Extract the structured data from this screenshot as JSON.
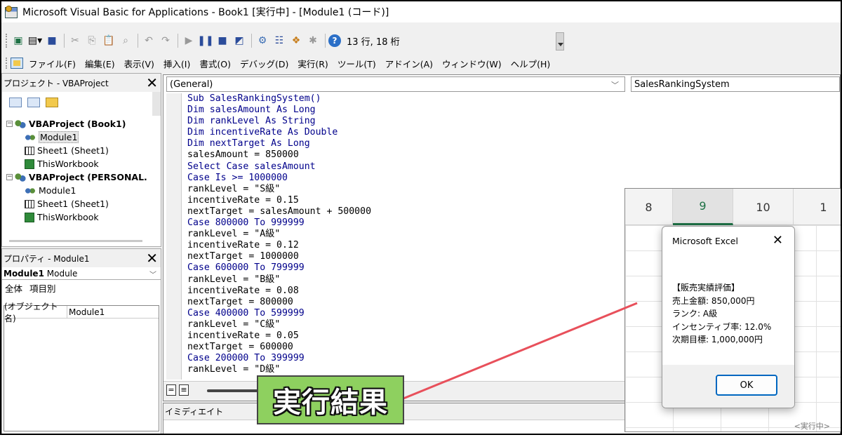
{
  "window": {
    "title": "Microsoft Visual Basic for Applications - Book1 [実行中] - [Module1 (コード)]"
  },
  "toolbar": {
    "status": "13 行, 18 桁"
  },
  "menu": [
    "ファイル(F)",
    "編集(E)",
    "表示(V)",
    "挿入(I)",
    "書式(O)",
    "デバッグ(D)",
    "実行(R)",
    "ツール(T)",
    "アドイン(A)",
    "ウィンドウ(W)",
    "ヘルプ(H)"
  ],
  "project": {
    "title": "プロジェクト - VBAProject",
    "close": "✕",
    "tree": [
      {
        "label": "VBAProject (Book1)",
        "kind": "project",
        "level": 0
      },
      {
        "label": "Module1",
        "kind": "module",
        "level": 1
      },
      {
        "label": "Sheet1 (Sheet1)",
        "kind": "sheet",
        "level": 1
      },
      {
        "label": "ThisWorkbook",
        "kind": "workbook",
        "level": 1
      },
      {
        "label": "VBAProject (PERSONAL.",
        "kind": "project",
        "level": 0
      },
      {
        "label": "Module1",
        "kind": "module",
        "level": 1
      },
      {
        "label": "Sheet1 (Sheet1)",
        "kind": "sheet",
        "level": 1
      },
      {
        "label": "ThisWorkbook",
        "kind": "workbook",
        "level": 1
      }
    ]
  },
  "properties": {
    "title": "プロパティ - Module1",
    "close": "✕",
    "object_bold": "Module1",
    "object_type": "Module",
    "tab_all": "全体",
    "tab_category": "項目別",
    "row_key": "(オブジェクト名)",
    "row_value": "Module1"
  },
  "code": {
    "object_combo": "(General)",
    "proc_combo": "SalesRankingSystem",
    "lines": [
      "Sub SalesRankingSystem()",
      "Dim salesAmount As Long",
      "Dim rankLevel As String",
      "Dim incentiveRate As Double",
      "Dim nextTarget As Long",
      "salesAmount = 850000",
      "Select Case salesAmount",
      "Case Is >= 1000000",
      "rankLevel = \"S級\"",
      "incentiveRate = 0.15",
      "nextTarget = salesAmount + 500000",
      "Case 800000 To 999999",
      "rankLevel = \"A級\"",
      "incentiveRate = 0.12",
      "nextTarget = 1000000",
      "Case 600000 To 799999",
      "rankLevel = \"B級\"",
      "incentiveRate = 0.08",
      "nextTarget = 800000",
      "Case 400000 To 599999",
      "rankLevel = \"C級\"",
      "incentiveRate = 0.05",
      "nextTarget = 600000",
      "Case 200000 To 399999",
      "rankLevel = \"D級\""
    ]
  },
  "immediate": {
    "title": "イミディエイト"
  },
  "callout": {
    "label": "実行結果"
  },
  "excel": {
    "columns": [
      "8",
      "9",
      "10",
      "1"
    ],
    "selected_column": "9",
    "status": "<実行中>"
  },
  "msgbox": {
    "title": "Microsoft Excel",
    "close": "✕",
    "lines": [
      "【販売実績評価】",
      "売上金額: 850,000円",
      "ランク: A級",
      "インセンティブ率: 12.0%",
      "次期目標: 1,000,000円"
    ],
    "ok": "OK"
  },
  "colors": {
    "keyword": "#00008b",
    "callout_bg": "#8ed05f",
    "arrow": "#e8505b",
    "excel_accent": "#1e7145",
    "ok_border": "#0067c0"
  }
}
